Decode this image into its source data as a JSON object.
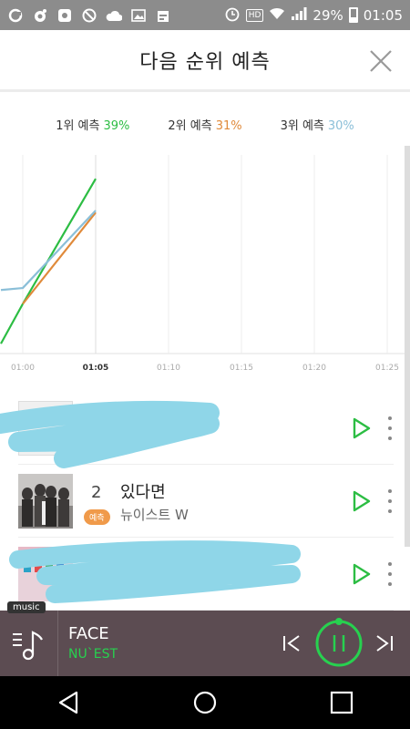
{
  "status_bar": {
    "battery": "29%",
    "time": "01:05",
    "hd": "HD"
  },
  "header": {
    "title": "다음 순위 예측"
  },
  "legend": [
    {
      "label": "1위 예측",
      "pct": "39%",
      "color": "#2cbd43"
    },
    {
      "label": "2위 예측",
      "pct": "31%",
      "color": "#e08a3a"
    },
    {
      "label": "3위 예측",
      "pct": "30%",
      "color": "#8bbfd8"
    }
  ],
  "chart_data": {
    "type": "line",
    "x": [
      "01:00",
      "01:05",
      "01:10",
      "01:15",
      "01:20",
      "01:25"
    ],
    "series": [
      {
        "name": "1위 예측",
        "color": "#2cbd43",
        "points": [
          [
            -0.3,
            0.05
          ],
          [
            0,
            0.25
          ],
          [
            1,
            0.88
          ]
        ]
      },
      {
        "name": "2위 예측",
        "color": "#e08a3a",
        "points": [
          [
            0,
            0.25
          ],
          [
            1,
            0.71
          ]
        ]
      },
      {
        "name": "3위 예측",
        "color": "#8bbfd8",
        "points": [
          [
            -0.3,
            0.32
          ],
          [
            0,
            0.33
          ],
          [
            1,
            0.72
          ]
        ]
      }
    ],
    "ylim": [
      0,
      1
    ],
    "grid": true
  },
  "list": [
    {
      "rank": "",
      "badge": "",
      "title": "",
      "artist": "",
      "obscured": true
    },
    {
      "rank": "2",
      "badge": "예측",
      "title": "있다면",
      "artist": "뉴이스트 W",
      "obscured": false
    },
    {
      "rank": "",
      "badge": "",
      "title": "",
      "artist": "",
      "obscured": true
    }
  ],
  "player": {
    "tag": "music",
    "title": "FACE",
    "artist": "NU`EST",
    "accent": "#27d14f"
  }
}
